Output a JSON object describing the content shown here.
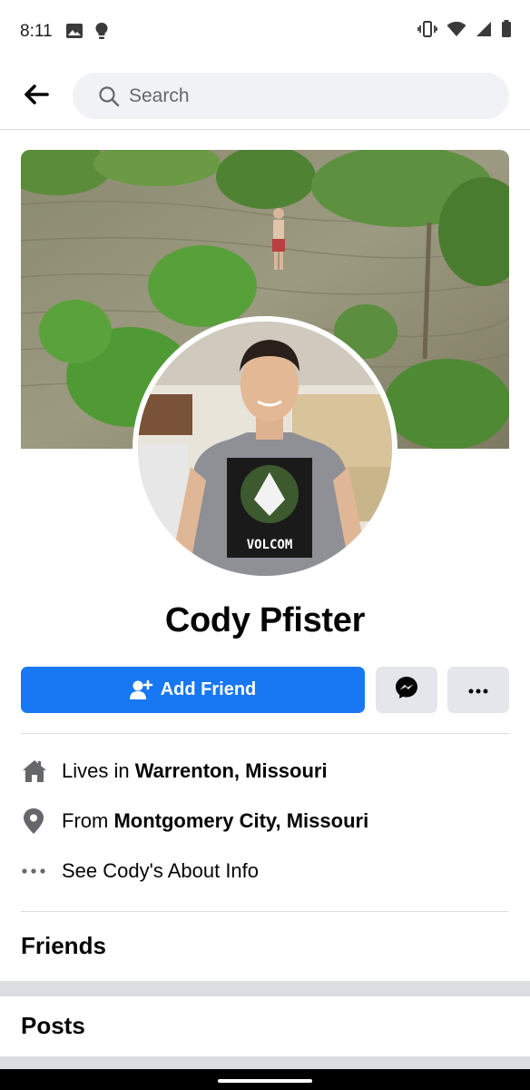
{
  "status_bar": {
    "time": "8:11",
    "left_icons": [
      "image-icon",
      "bulb-icon"
    ],
    "right_icons": [
      "vibrate-icon",
      "wifi-icon",
      "signal-icon",
      "battery-icon"
    ]
  },
  "top_nav": {
    "back_icon": "back-arrow-icon",
    "search_placeholder": "Search"
  },
  "profile": {
    "name": "Cody Pfister",
    "shirt_text": "VOLCOM"
  },
  "actions": {
    "add_friend_label": "Add Friend",
    "add_friend_icon": "add-friend-icon",
    "messenger_icon": "messenger-icon",
    "more_icon": "more-icon"
  },
  "intro": {
    "lives_prefix": "Lives in",
    "lives_place": "Warrenton, Missouri",
    "from_prefix": "From",
    "from_place": "Montgomery City, Missouri",
    "about_label": "See Cody's About Info"
  },
  "sections": {
    "friends": "Friends",
    "posts": "Posts"
  },
  "colors": {
    "primary": "#1877f2",
    "secondary_button": "#e4e6eb",
    "search_bg": "#f0f2f5",
    "divider": "#dadde1",
    "icon_gray": "#65676b"
  }
}
